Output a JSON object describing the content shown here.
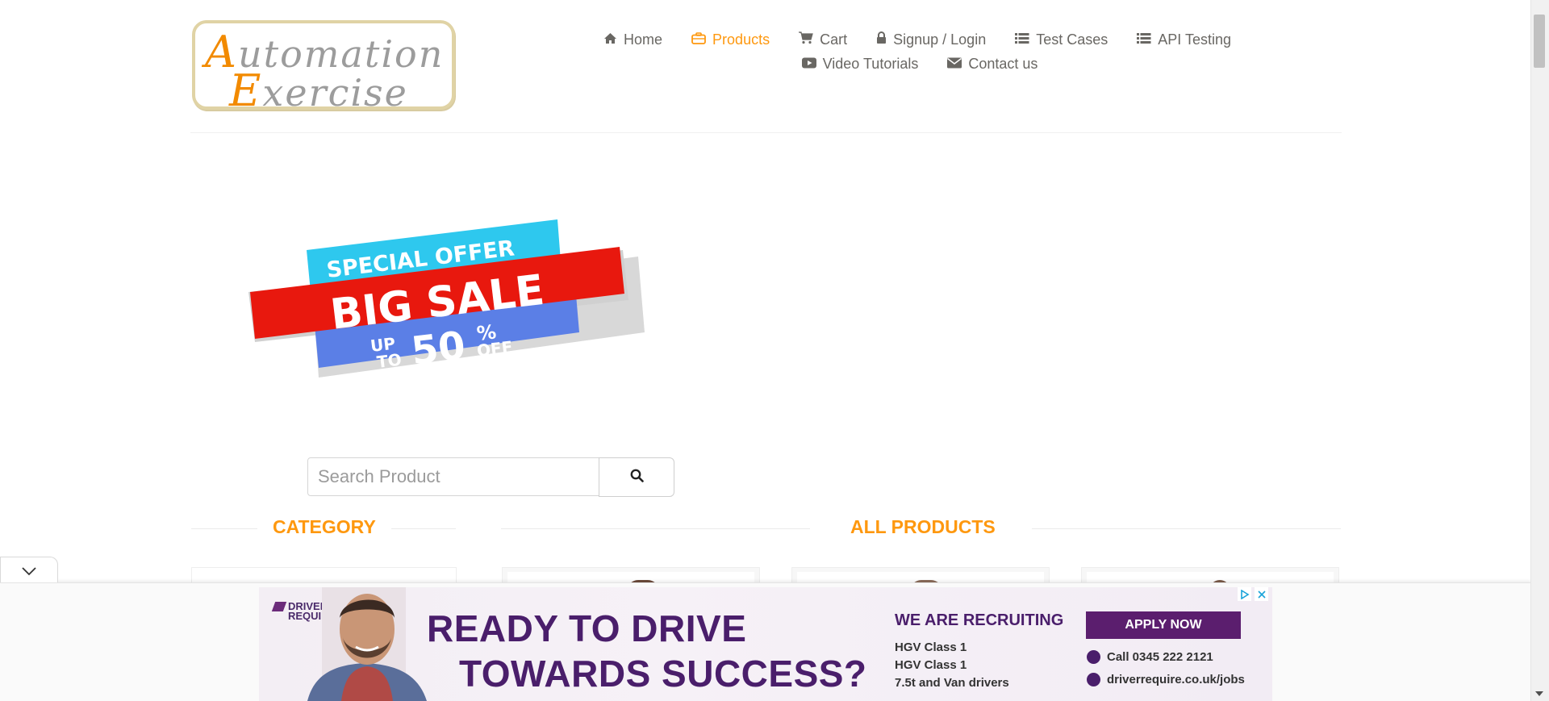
{
  "brand": {
    "logo_line1_first": "A",
    "logo_line1_rest": "utomation",
    "logo_line2_first": "E",
    "logo_line2_rest": "xercise",
    "accent": "#fe980f"
  },
  "nav": {
    "items": [
      {
        "label": "Home",
        "icon": "home-icon"
      },
      {
        "label": "Products",
        "icon": "products-icon",
        "active": true
      },
      {
        "label": "Cart",
        "icon": "cart-icon"
      },
      {
        "label": "Signup / Login",
        "icon": "lock-icon"
      },
      {
        "label": "Test Cases",
        "icon": "list-icon"
      },
      {
        "label": "API Testing",
        "icon": "list-icon"
      },
      {
        "label": "Video Tutorials",
        "icon": "youtube-icon"
      },
      {
        "label": "Contact us",
        "icon": "envelope-icon"
      }
    ]
  },
  "banner": {
    "line1": "SPECIAL OFFER",
    "line2": "BIG SALE",
    "line3_up": "UP",
    "line3_to": "TO",
    "line3_pct": "50",
    "line3_symbol": "%",
    "line3_off": "OFF"
  },
  "search": {
    "placeholder": "Search Product",
    "value": ""
  },
  "sections": {
    "category_title": "Category",
    "all_products_title": "All Products"
  },
  "ad": {
    "brand_line1": "DRIVER",
    "brand_line2": "REQUIRE",
    "headline1": "READY TO DRIVE",
    "headline2": "TOWARDS SUCCESS?",
    "recruit": "WE ARE RECRUITING",
    "roles": [
      "HGV Class 1",
      "HGV Class 1",
      "7.5t and Van drivers"
    ],
    "apply_label": "APPLY NOW",
    "phone": "Call 0345 222 2121",
    "website": "driverrequire.co.uk/jobs"
  }
}
